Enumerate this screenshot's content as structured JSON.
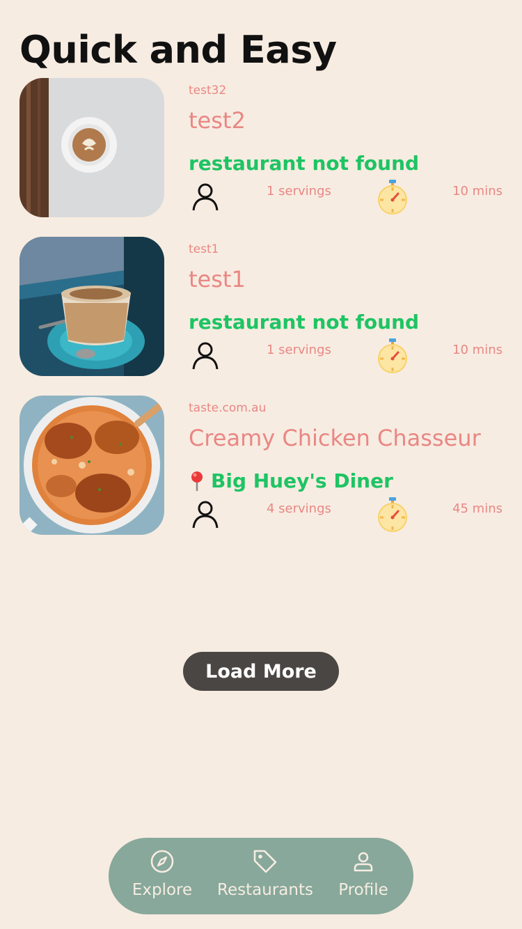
{
  "page": {
    "title": "Quick and Easy"
  },
  "recipes": [
    {
      "source": "test32",
      "title": "test2",
      "restaurant": "restaurant not found",
      "has_pin": false,
      "servings": "1 servings",
      "time": "10 mins",
      "image": "latte-art-coffee-cup"
    },
    {
      "source": "test1",
      "title": "test1",
      "restaurant": "restaurant not found",
      "has_pin": false,
      "servings": "1 servings",
      "time": "10 mins",
      "image": "coffee-glass-on-saucer"
    },
    {
      "source": "taste.com.au",
      "title": "Creamy Chicken Chasseur",
      "restaurant": "Big Huey's Diner",
      "has_pin": true,
      "servings": "4 servings",
      "time": "45 mins",
      "image": "chicken-chasseur-pan"
    }
  ],
  "load_more": {
    "label": "Load More"
  },
  "nav": [
    {
      "label": "Explore",
      "icon": "compass-icon"
    },
    {
      "label": "Restaurants",
      "icon": "tag-icon"
    },
    {
      "label": "Profile",
      "icon": "person-icon"
    }
  ],
  "colors": {
    "background": "#f7ece2",
    "accent_text": "#e98783",
    "restaurant_green": "#1ec463",
    "nav_background": "#87a89a",
    "button_dark": "#4a4643"
  }
}
